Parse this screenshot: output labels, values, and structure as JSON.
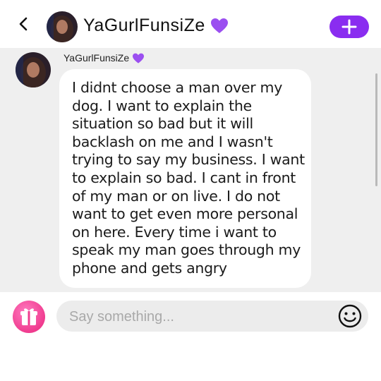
{
  "header": {
    "name": "YaGurlFunsiZe",
    "back_icon": "chevron-left-icon",
    "action_icon": "plus-icon",
    "accent": "#8a2df0"
  },
  "message": {
    "sender": "YaGurlFunsiZe",
    "lines": [
      "I didnt choose a man over my",
      "dog. I want to explain the",
      "situation so bad but it will",
      "backlash on me and I wasn't",
      "trying to say my business. I want",
      "to explain so bad. I cant in front",
      "of my man or on live. I do not",
      "want to get even more personal",
      "on here. Every time i want to",
      "speak my man goes through my",
      "phone and gets angry"
    ]
  },
  "composer": {
    "placeholder": "Say something...",
    "gift_icon": "gift-icon",
    "emoji_icon": "smiley-icon"
  }
}
